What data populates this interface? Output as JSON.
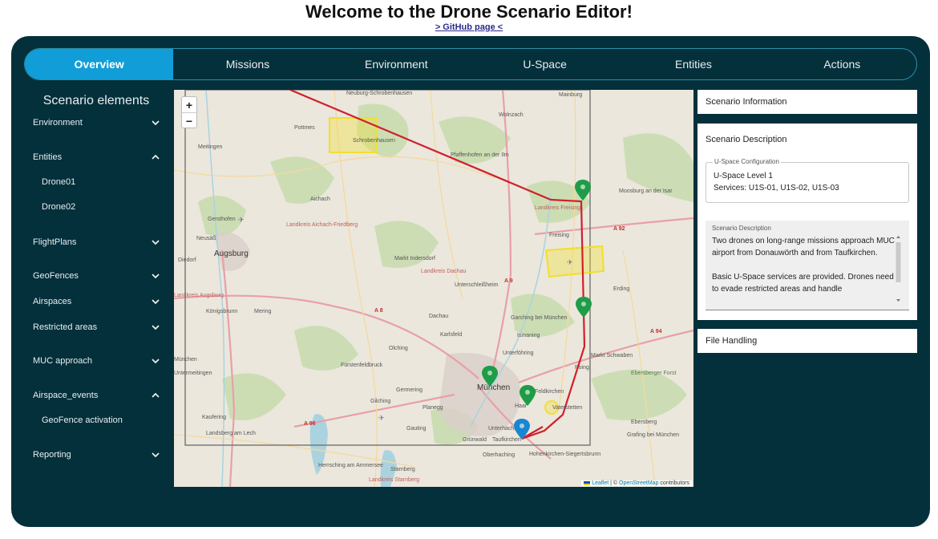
{
  "header": {
    "title": "Welcome to the Drone Scenario Editor!",
    "github_link": "> GitHub page <"
  },
  "tabs": [
    {
      "label": "Overview",
      "active": true
    },
    {
      "label": "Missions"
    },
    {
      "label": "Environment"
    },
    {
      "label": "U-Space"
    },
    {
      "label": "Entities"
    },
    {
      "label": "Actions"
    }
  ],
  "sidebar": {
    "title": "Scenario elements",
    "items": [
      {
        "label": "Environment",
        "expanded": false
      },
      {
        "label": "Entities",
        "expanded": true,
        "children": [
          "Drone01",
          "Drone02"
        ]
      },
      {
        "label": "FlightPlans",
        "expanded": false
      },
      {
        "label": "GeoFences",
        "expanded": false
      },
      {
        "label": "Airspaces",
        "expanded": false
      },
      {
        "label": "Restricted areas",
        "expanded": false
      },
      {
        "label": "MUC approach",
        "expanded": false
      },
      {
        "label": "Airspace_events",
        "expanded": true,
        "children": [
          "GeoFence activation"
        ]
      },
      {
        "label": "Reporting",
        "expanded": false
      }
    ]
  },
  "map": {
    "zoom_in": "+",
    "zoom_out": "−",
    "attribution": {
      "leaflet": "Leaflet",
      "sep": "| ©",
      "osm": "OpenStreetMap",
      "suffix": "contributors"
    },
    "places": {
      "neuburg": "Neuburg-Schrobenhausen",
      "mainburg": "Mainburg",
      "wolnzach": "Wolnzach",
      "pottmes": "Pottmes",
      "schrobenhausen": "Schrobenhausen",
      "pfaffenhofen": "Pfaffenhofen an der Ilm",
      "meitingen": "Meitingen",
      "aichach": "Aichach",
      "moosburg": "Moosburg an der Isar",
      "gersthofen": "Gersthofen",
      "lk_freising": "Landkreis Freising",
      "lk_aichach": "Landkreis Aichach-Friedberg",
      "neusass": "Neusäß",
      "augsburg": "Augsburg",
      "freising": "Freising",
      "diedorf": "Diedorf",
      "markt_indersdorf": "Markt Indersdorf",
      "lk_dachau": "Landkreis Dachau",
      "erding": "Erding",
      "lk_augsburg": "Landkreis Augsburg",
      "koenigsbrunn": "Königsbrunn",
      "mering": "Mering",
      "unterschleissheim": "Unterschleißheim",
      "dachau": "Dachau",
      "karlsfeld": "Karlsfeld",
      "garching": "Garching bei München",
      "ismaning": "Ismaning",
      "unterfoehring": "Unterföhring",
      "markt_schwaben": "Markt Schwaben",
      "olching": "Olching",
      "fuerstenfeldbruck": "Fürstenfeldbruck",
      "muenchen": "München",
      "poing": "Poing",
      "untermeitingen": "Untermeitingen",
      "ebersberger_forst": "Ebersberger Forst",
      "germering": "Germering",
      "gilching": "Gilching",
      "planegg": "Planegg",
      "feldkirchen": "Feldkirchen",
      "haar": "Haar",
      "vaterstetten": "Vaterstetten",
      "kaufering": "Kaufering",
      "ebersberg": "Ebersberg",
      "landsberg": "Landsberg am Lech",
      "gauting": "Gauting",
      "gruenwald": "Grünwald",
      "unterhaching": "Unterhaching",
      "taufkirchen": "Taufkirchen",
      "grafing": "Grafing bei München",
      "oberhaching": "Oberhaching",
      "hohenkirchen": "Hohenkirchen-Siegertsbrunn",
      "herrsching": "Herrsching am Ammersee",
      "starnberg": "Starnberg",
      "lk_starnberg": "Landkreis Starnberg",
      "a9": "A 9",
      "a92": "A 92",
      "a8": "A 8",
      "a94": "A 94",
      "a96": "A 96",
      "muenchen_left": "München"
    }
  },
  "right_panel": {
    "info_title": "Scenario Information",
    "description_title": "Scenario Description",
    "uspace_legend": "U-Space Configuration",
    "uspace_line1": "U-Space Level 1",
    "uspace_line2": "Services: U1S-01, U1S-02, U1S-03",
    "desc_legend": "Scenario Description",
    "desc_text_1": "Two drones on long-range missions approach MUC airport from Donauwörth and from Taufkirchen.",
    "desc_text_2": "Basic U-Space services are provided. Drones need to evade restricted areas and handle",
    "file_title": "File Handling"
  },
  "colors": {
    "panel_bg": "#03303b",
    "tab_active": "#119ed8",
    "route": "#d0202a",
    "fence": "#f2df2a",
    "marker_green": "#1f9c47",
    "marker_blue": "#1a86d0"
  }
}
